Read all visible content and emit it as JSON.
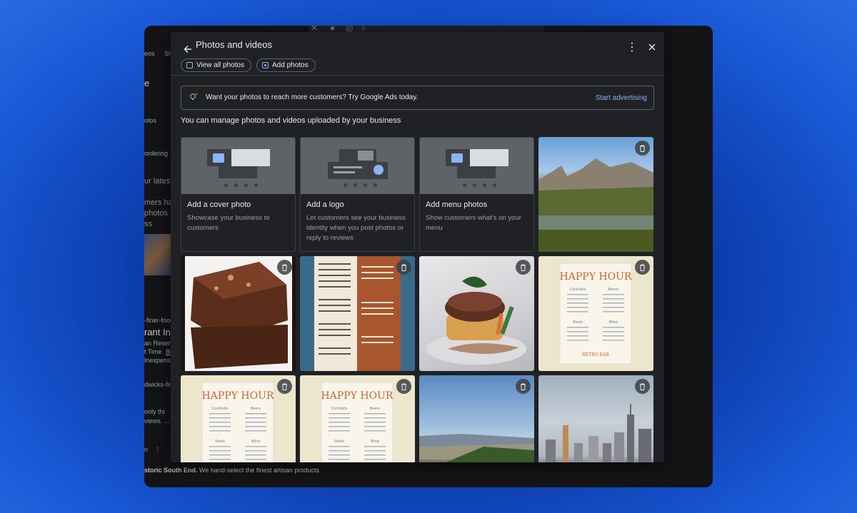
{
  "background": {
    "search_icons": [
      "close-icon",
      "mic-icon",
      "lens-icon",
      "search-icon"
    ],
    "fragments": {
      "videos": "eos",
      "shopping": "Sh",
      "e": "e",
      "photos": "otos",
      "ordering": "ordering",
      "latest": "ur latest",
      "mers": "mers ha",
      "photos2": "photos",
      "ss": "ss",
      "domain1": "-finer-foods.",
      "restaurant": "rant Inf",
      "reserv": "an Reserv",
      "time": "t Time",
      "be": "Be",
      "inexpens": "Inexpens",
      "domain2": "dwicks-finer.",
      "only": "only thi",
      "views": "views.",
      "dots": "...",
      "n": "n",
      "bottom_bold": "storic South End.",
      "bottom_rest": " We hand-select the finest artisan products"
    }
  },
  "dialog": {
    "title": "Photos and videos",
    "chips": {
      "view_all": "View all photos",
      "add_photos": "Add photos"
    },
    "ads": {
      "text": "Want your photos to reach more customers? Try Google Ads today.",
      "link": "Start advertising"
    },
    "manage_text": "You can manage photos and videos uploaded by your business",
    "cards": [
      {
        "title": "Add a cover photo",
        "desc": "Showcase your business to customers"
      },
      {
        "title": "Add a logo",
        "desc": "Let customers see your business identity when you post photos or reply to reviews"
      },
      {
        "title": "Add menu photos",
        "desc": "Show customers what's on your menu"
      }
    ],
    "happy_hour": {
      "title": "HAPPY HOUR",
      "cocktails": "Cocktails",
      "beers": "Beers",
      "shots": "Shots",
      "wine": "Wine",
      "footer": "RETRO BAR"
    }
  },
  "colors": {
    "dialog_bg": "#202124",
    "accent_link": "#8ab4f8",
    "happy_hour_title": "#c8652e"
  }
}
